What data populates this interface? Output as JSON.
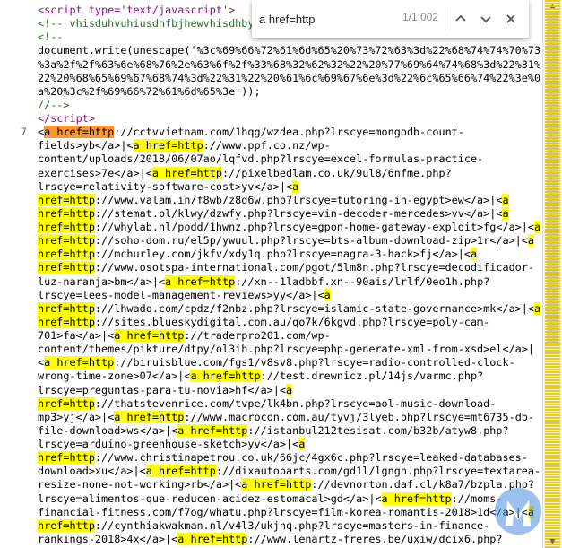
{
  "find_bar": {
    "query": "a href=http",
    "count": "1/1,002"
  },
  "source": {
    "gutter": [
      {
        "n": "",
        "row": 0
      },
      {
        "n": "",
        "row": 1
      },
      {
        "n": "",
        "row": 2
      },
      {
        "n": "",
        "row": 3
      },
      {
        "n": "",
        "row": 4
      },
      {
        "n": "",
        "row": 5
      },
      {
        "n": "",
        "row": 6
      },
      {
        "n": "7",
        "row": 7
      }
    ]
  },
  "logo": {
    "name": "malwarebytes-logo-icon",
    "color": "#4d8fe0"
  },
  "colors": {
    "highlight": "#ffff00",
    "current_match": "#ff9632",
    "tag": "#881280",
    "attr": "#994500",
    "value": "#1a1aa6",
    "comment": "#236e25"
  }
}
